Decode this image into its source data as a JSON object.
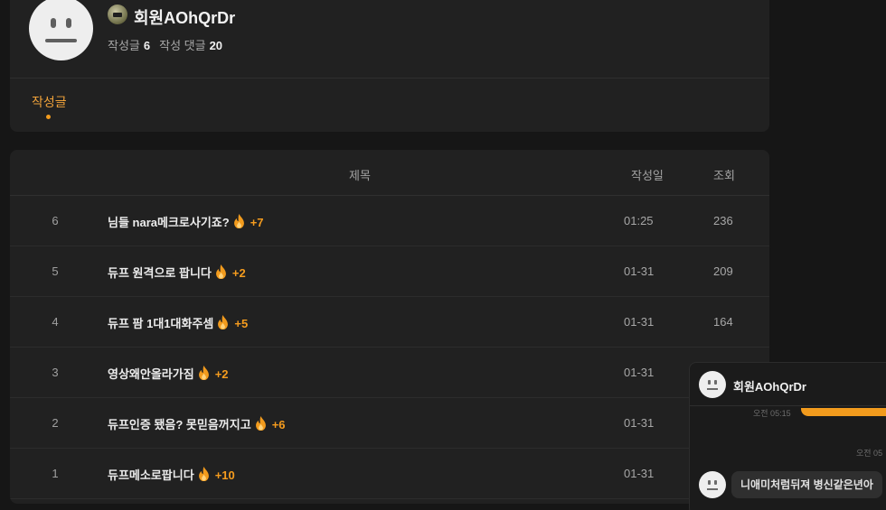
{
  "profile": {
    "username": "회원AOhQrDr",
    "stats": {
      "posts_label": "작성글",
      "posts_count": "6",
      "comments_label": "작성 댓글",
      "comments_count": "20"
    },
    "active_tab": "작성글"
  },
  "table": {
    "headers": {
      "title": "제목",
      "date": "작성일",
      "views": "조회"
    },
    "rows": [
      {
        "num": "6",
        "title": "님들 nara메크로사기죠?",
        "count": "+7",
        "date": "01:25",
        "views": "236"
      },
      {
        "num": "5",
        "title": "듀프 원격으로 팝니다",
        "count": "+2",
        "date": "01-31",
        "views": "209"
      },
      {
        "num": "4",
        "title": "듀프 팜 1대1대화주셈",
        "count": "+5",
        "date": "01-31",
        "views": "164"
      },
      {
        "num": "3",
        "title": "영상왜안올라가짐",
        "count": "+2",
        "date": "01-31",
        "views": ""
      },
      {
        "num": "2",
        "title": "듀프인증 됐음? 못믿음꺼지고",
        "count": "+6",
        "date": "01-31",
        "views": ""
      },
      {
        "num": "1",
        "title": "듀프메소로팝니다",
        "count": "+10",
        "date": "01-31",
        "views": ""
      }
    ]
  },
  "chat": {
    "name": "회원AOhQrDr",
    "time1": "오전 05:15",
    "time2": "오전 05",
    "message": "니애미처럼뒤져 병신같은년아"
  },
  "colors": {
    "accent": "#f29b1d",
    "background": "#161616",
    "card": "#212121"
  },
  "icons": {
    "trend": "fire-icon",
    "avatar": "neutral-face-avatar",
    "level": "level-badge-icon"
  }
}
